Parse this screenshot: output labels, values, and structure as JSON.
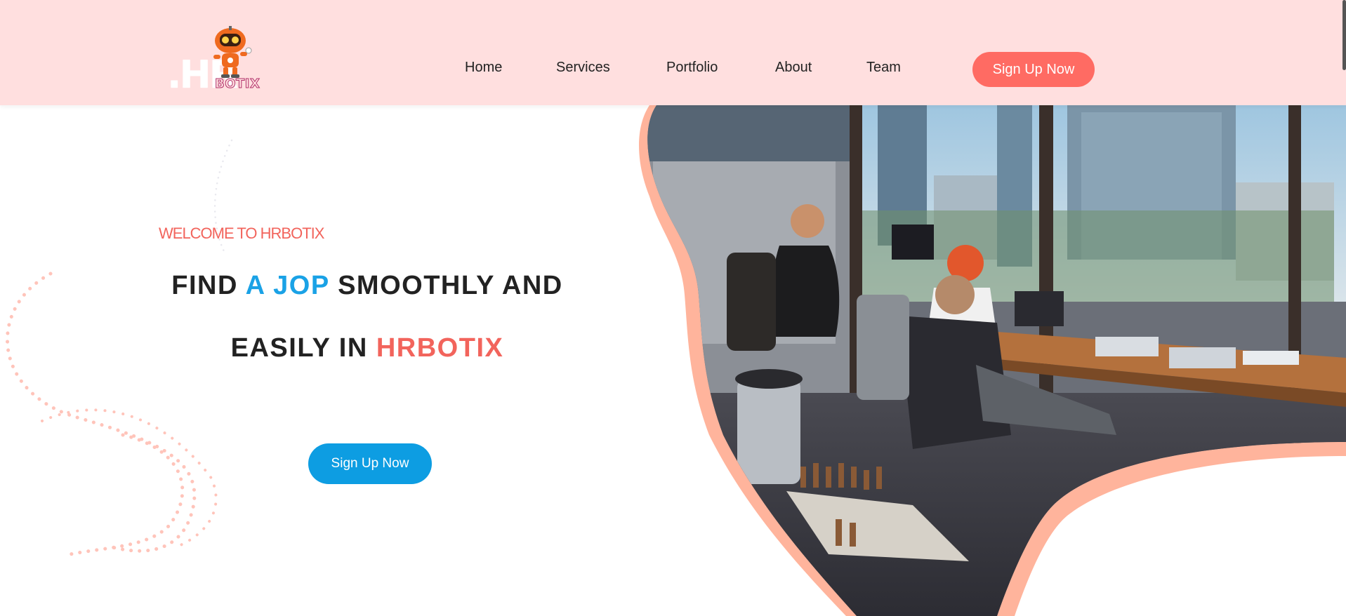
{
  "brand": {
    "logo_initials": ".HR",
    "logo_name": "BOTIX"
  },
  "nav": {
    "items": [
      {
        "label": "Home"
      },
      {
        "label": "Services"
      },
      {
        "label": "Portfolio"
      },
      {
        "label": "About"
      },
      {
        "label": "Team"
      }
    ],
    "cta_label": "Sign Up Now"
  },
  "hero": {
    "welcome": "WELCOME TO HRBOTIX",
    "headline_line1_a": "FIND ",
    "headline_line1_b": "A JOP",
    "headline_line1_c": " SMOOTHLY AND",
    "headline_line2_a": "EASILY IN ",
    "headline_line2_b": "HRBOTIX",
    "cta_label": "Sign Up Now",
    "image_subject": "office-coworking-photo"
  },
  "colors": {
    "header_bg": "#ffdfdf",
    "accent_red": "#f2645c",
    "accent_blue": "#1aa2e6",
    "cta_blue": "#0d9de2",
    "blob_peach": "#ffb49c"
  }
}
